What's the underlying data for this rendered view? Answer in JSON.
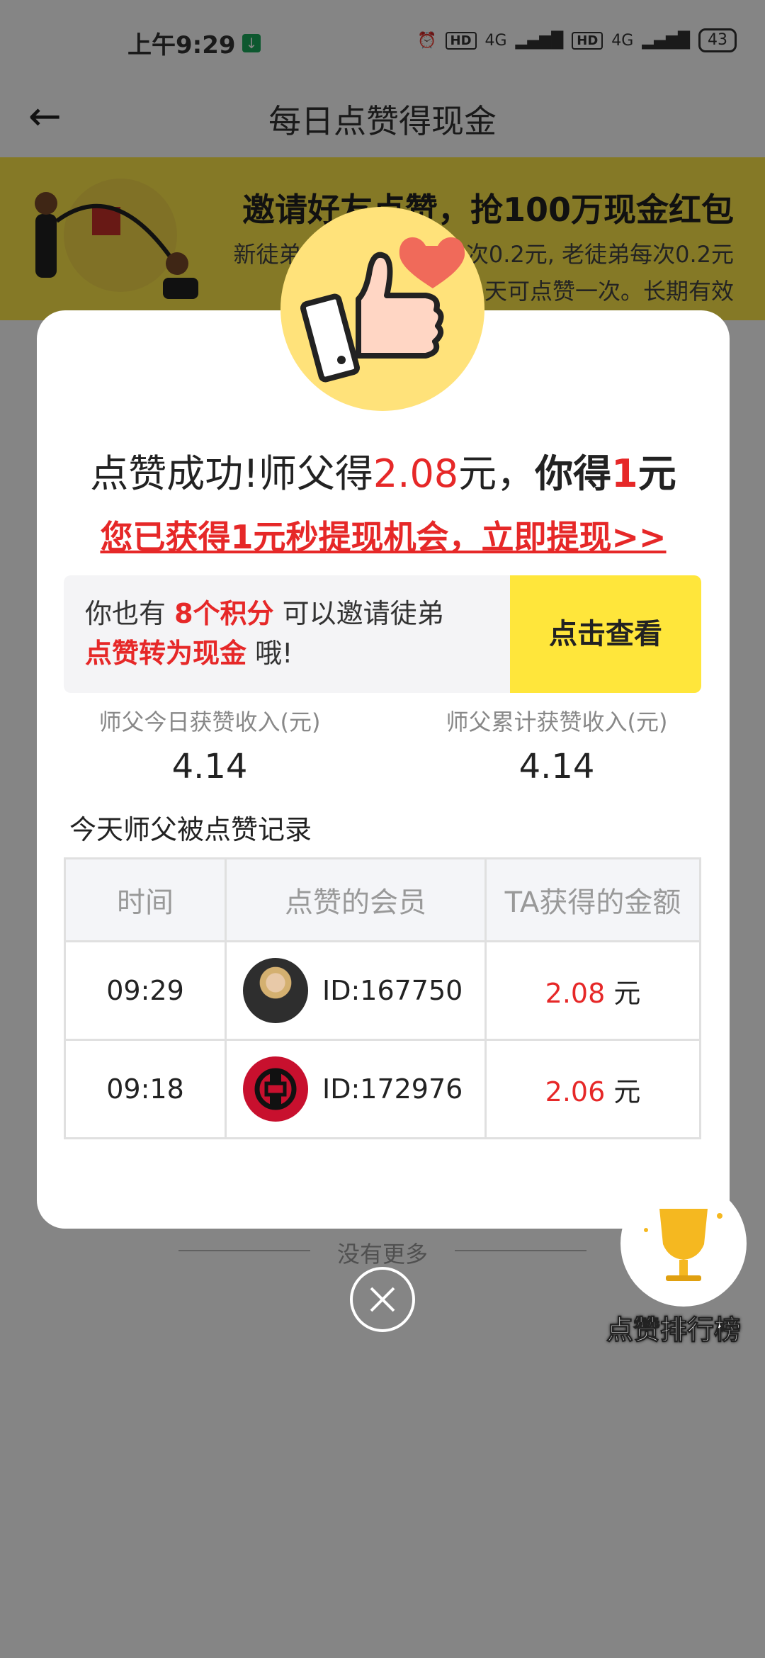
{
  "status_bar": {
    "time": "上午9:29",
    "signal_badge": "HD",
    "network": "4G",
    "battery": "43"
  },
  "nav": {
    "title": "每日点赞得现金"
  },
  "banner": {
    "title": "邀请好友点赞，抢100万现金红包",
    "line1": "新徒弟点",
    "line1_right": "次0.2元, 老徒弟每次0.2元",
    "line2_right": "天可点赞一次。长期有效"
  },
  "page": {
    "no_more": "没有更多"
  },
  "modal": {
    "success_prefix": "点赞成功!师父得",
    "master_amount": "2.08",
    "success_mid": "元，",
    "you_get": "你得",
    "your_amount": "1",
    "your_unit": "元",
    "withdraw_link": "您已获得1元秒提现机会，立即提现>>",
    "invite": {
      "text_a": "你也有 ",
      "points": "8个积分",
      "text_b": " 可以邀请徒弟",
      "convert": "点赞转为现金",
      "text_c": " 哦!",
      "button": "点击查看"
    },
    "stats": [
      {
        "label": "师父今日获赞收入(元)",
        "value": "4.14"
      },
      {
        "label": "师父累计获赞收入(元)",
        "value": "4.14"
      }
    ],
    "records_title": "今天师父被点赞记录",
    "table": {
      "headers": [
        "时间",
        "点赞的会员",
        "TA获得的金额"
      ],
      "rows": [
        {
          "time": "09:29",
          "member": "ID:167750",
          "amount": "2.08",
          "unit": "元"
        },
        {
          "time": "09:18",
          "member": "ID:172976",
          "amount": "2.06",
          "unit": "元"
        }
      ]
    }
  },
  "rank": {
    "label": "点赞排行榜"
  },
  "icons": {
    "back": "arrow-left-icon",
    "close": "close-icon",
    "thumb": "thumbs-up-heart-icon",
    "trophy": "trophy-icon"
  },
  "colors": {
    "accent_yellow": "#ffe63b",
    "accent_red": "#e62828"
  }
}
